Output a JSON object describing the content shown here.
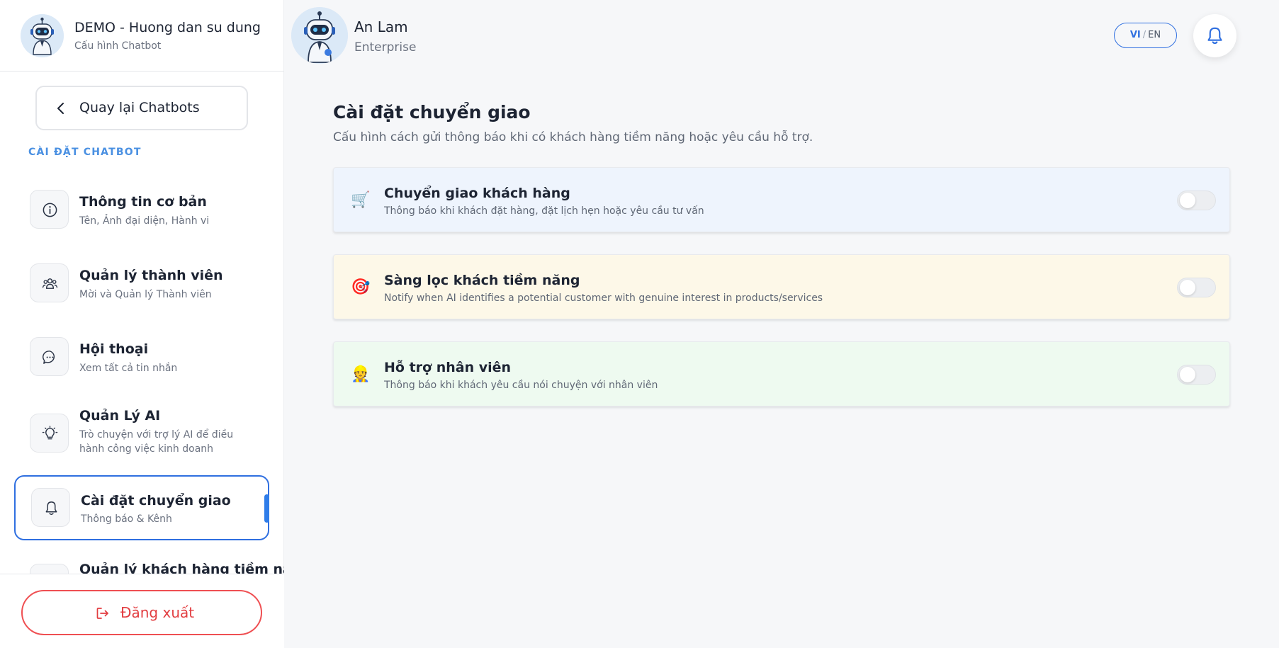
{
  "sidebar": {
    "bot_name": "DEMO - Huong dan su dung",
    "bot_subtitle": "Cấu hình Chatbot",
    "back_label": "Quay lại Chatbots",
    "section_label": "CÀI ĐẶT CHATBOT",
    "items": [
      {
        "title": "Thông tin cơ bản",
        "subtitle": "Tên, Ảnh đại diện, Hành vi",
        "icon": "info-icon"
      },
      {
        "title": "Quản lý thành viên",
        "subtitle": "Mời và Quản lý Thành viên",
        "icon": "users-icon"
      },
      {
        "title": "Hội thoại",
        "subtitle": "Xem tất cả tin nhắn",
        "icon": "chat-bubble-icon"
      },
      {
        "title": "Quản Lý AI",
        "subtitle": "Trò chuyện với trợ lý AI để điều hành công việc kinh doanh",
        "icon": "lightbulb-icon"
      },
      {
        "title": "Cài đặt chuyển giao",
        "subtitle": "Thông báo & Kênh",
        "icon": "bell-icon",
        "active": true
      },
      {
        "title": "Quản lý khách hàng tiềm năng",
        "subtitle": "",
        "icon": "leads-icon"
      }
    ],
    "logout_label": "Đăng xuất"
  },
  "header": {
    "user_name": "An Lam",
    "user_plan": "Enterprise",
    "lang_vi": "VI",
    "lang_sep": "/",
    "lang_en": "EN"
  },
  "main": {
    "title": "Cài đặt chuyển giao",
    "description": "Cấu hình cách gửi thông báo khi có khách hàng tiềm năng hoặc yêu cầu hỗ trợ.",
    "cards": [
      {
        "title": "Chuyển giao khách hàng",
        "description": "Thông báo khi khách đặt hàng, đặt lịch hẹn hoặc yêu cầu tư vấn",
        "emoji": "🛒",
        "icon": "shopping-cart-icon",
        "enabled": false,
        "background": "#eef4fd"
      },
      {
        "title": "Sàng lọc khách tiềm năng",
        "description": "Notify when AI identifies a potential customer with genuine interest in products/services",
        "emoji": "🎯",
        "icon": "target-icon",
        "enabled": false,
        "background": "#fdf8e8"
      },
      {
        "title": "Hỗ trợ nhân viên",
        "description": "Thông báo khi khách yêu cầu nói chuyện với nhân viên",
        "emoji": "👷",
        "icon": "staff-icon",
        "enabled": false,
        "background": "#eefaf0"
      }
    ]
  },
  "colors": {
    "accent": "#2f6fe0",
    "danger": "#e23d40",
    "section_label": "#4a90e2"
  }
}
